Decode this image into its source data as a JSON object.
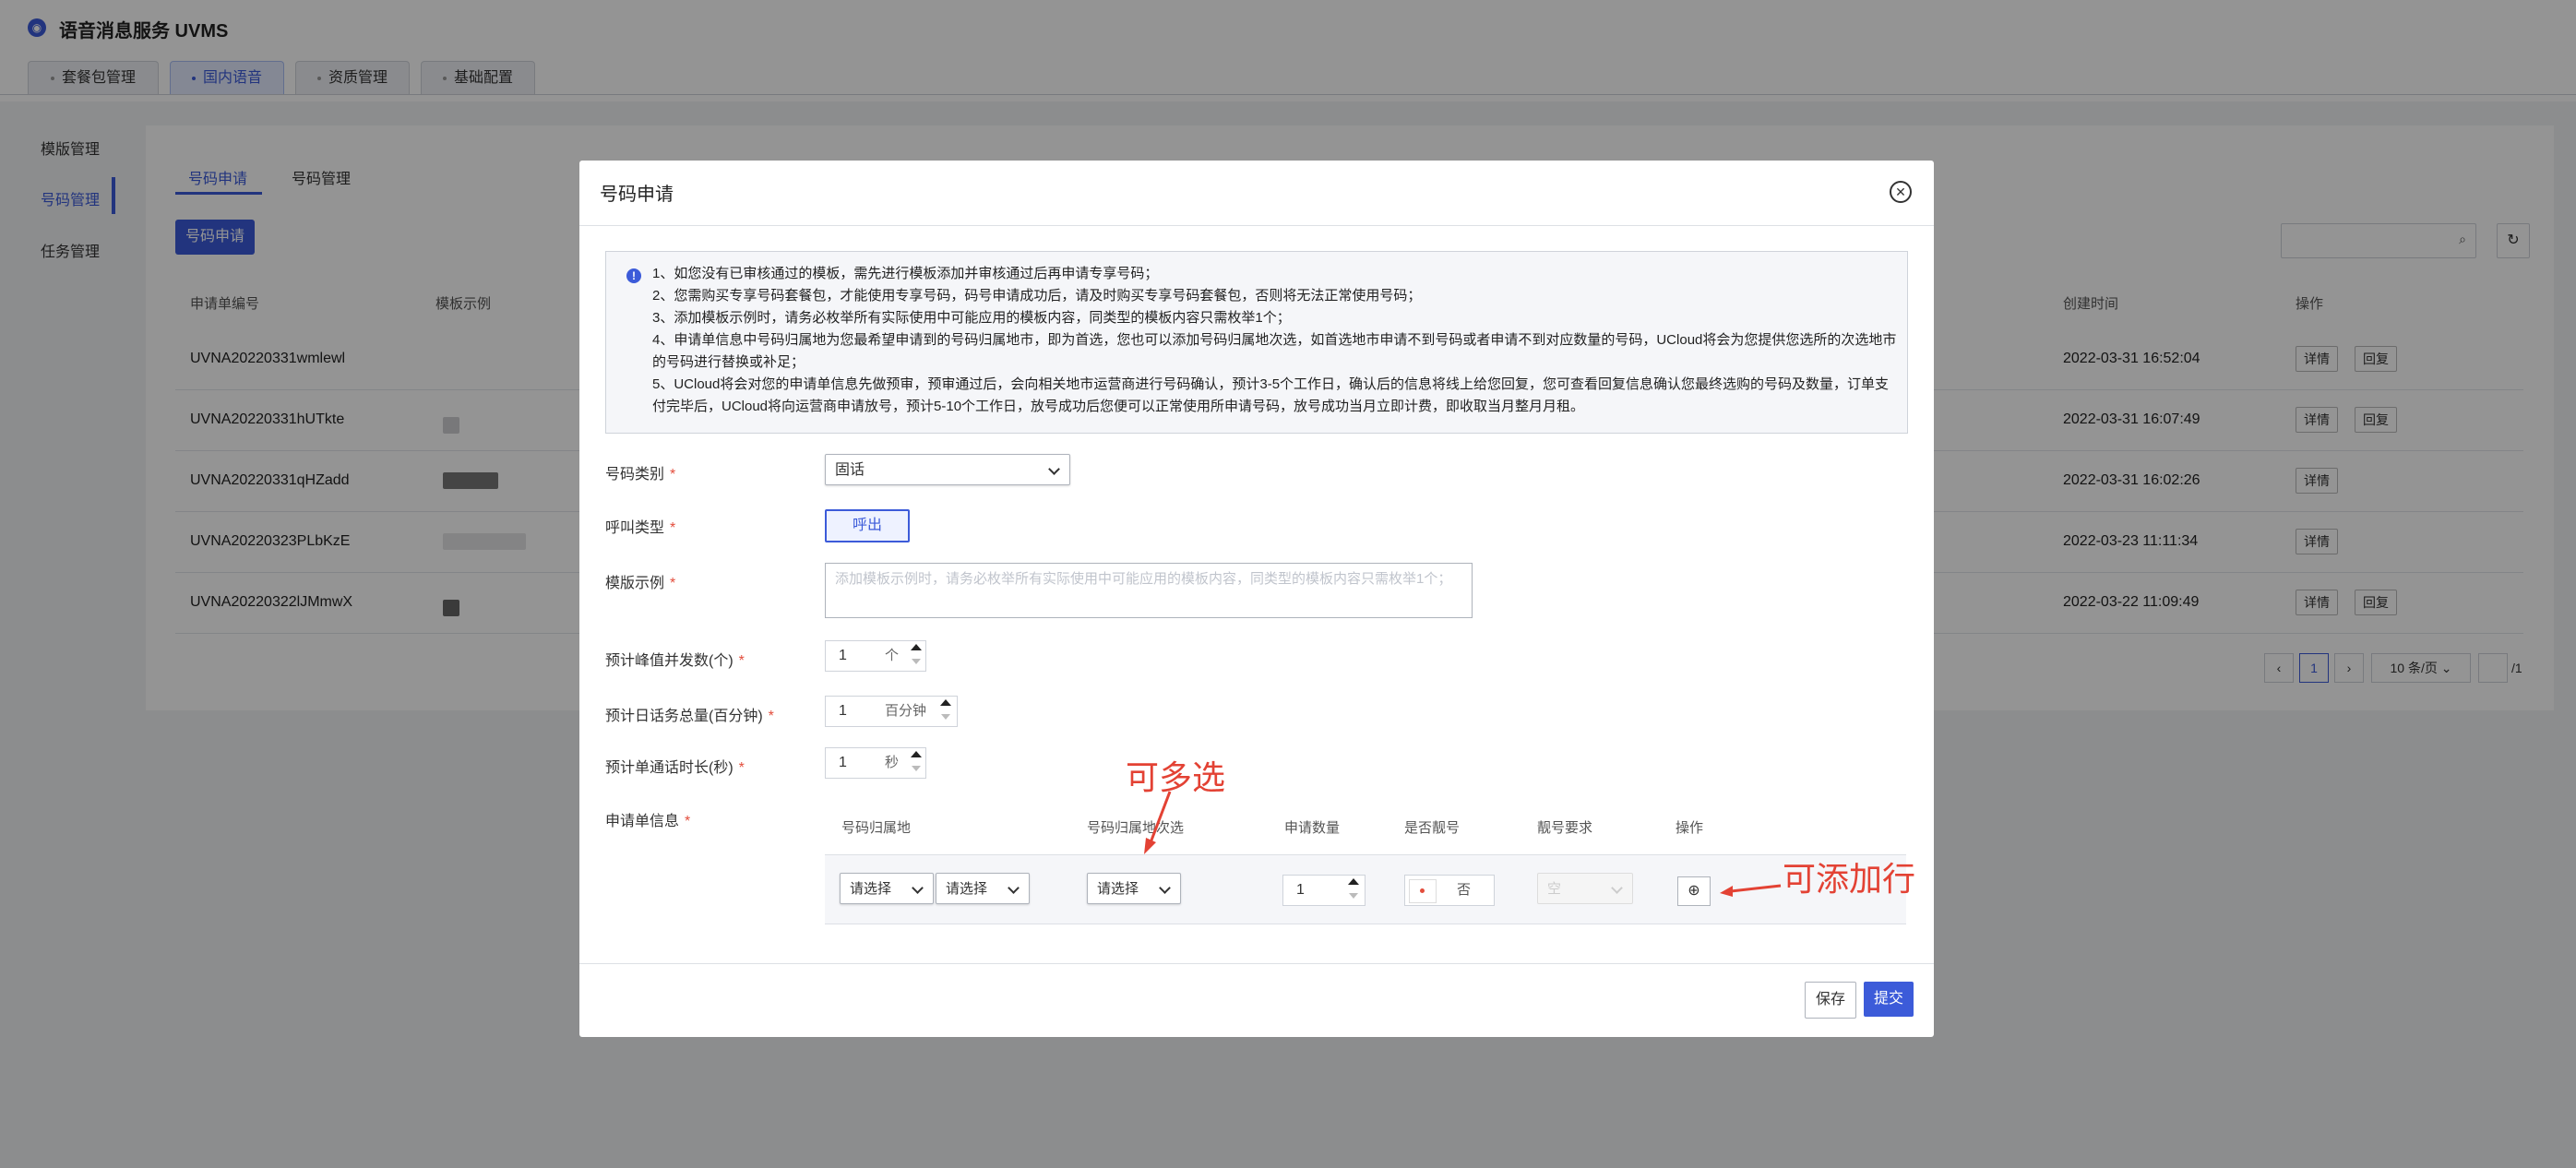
{
  "app": {
    "title": "语音消息服务 UVMS"
  },
  "top_tabs": [
    {
      "label": "套餐包管理"
    },
    {
      "label": "国内语音"
    },
    {
      "label": "资质管理"
    },
    {
      "label": "基础配置"
    }
  ],
  "sidebar": {
    "items": [
      {
        "label": "模版管理"
      },
      {
        "label": "号码管理"
      },
      {
        "label": "任务管理"
      }
    ]
  },
  "subtabs": [
    {
      "label": "号码申请"
    },
    {
      "label": "号码管理"
    }
  ],
  "apply_button": "号码申请",
  "table": {
    "headers": {
      "id": "申请单编号",
      "template": "模板示例",
      "created": "创建时间",
      "actions": "操作"
    },
    "rows": [
      {
        "id": "UVNA20220331wmlewl",
        "created": "2022-03-31 16:52:04",
        "detail": "详情",
        "reply": "回复"
      },
      {
        "id": "UVNA20220331hUTkte",
        "created": "2022-03-31 16:07:49",
        "detail": "详情",
        "reply": "回复"
      },
      {
        "id": "UVNA20220331qHZadd",
        "created": "2022-03-31 16:02:26",
        "detail": "详情",
        "reply": ""
      },
      {
        "id": "UVNA20220323PLbKzE",
        "created": "2022-03-23 11:11:34",
        "detail": "详情",
        "reply": ""
      },
      {
        "id": "UVNA20220322lJMmwX",
        "created": "2022-03-22 11:09:49",
        "detail": "详情",
        "reply": "回复"
      }
    ]
  },
  "pagination": {
    "current": "1",
    "page_size": "10 条/页",
    "total_pages": "/1"
  },
  "modal": {
    "title": "号码申请",
    "notice": [
      "1、如您没有已审核通过的模板，需先进行模板添加并审核通过后再申请专享号码；",
      "2、您需购买专享号码套餐包，才能使用专享号码，码号申请成功后，请及时购买专享号码套餐包，否则将无法正常使用号码；",
      "3、添加模板示例时，请务必枚举所有实际使用中可能应用的模板内容，同类型的模板内容只需枚举1个；",
      "4、申请单信息中号码归属地为您最希望申请到的号码归属地市，即为首选，您也可以添加号码归属地次选，如首选地市申请不到号码或者申请不到对应数量的号码，UCloud将会为您提供您选所的次选地市的号码进行替换或补足；",
      "5、UCloud将会对您的申请单信息先做预审，预审通过后，会向相关地市运营商进行号码确认，预计3-5个工作日，确认后的信息将线上给您回复，您可查看回复信息确认您最终选购的号码及数量，订单支付完毕后，UCloud将向运营商申请放号，预计5-10个工作日，放号成功后您便可以正常使用所申请号码，放号成功当月立即计费，即收取当月整月月租。"
    ],
    "fields": {
      "number_type": {
        "label": "号码类别",
        "value": "固话"
      },
      "call_type": {
        "label": "呼叫类型",
        "value": "呼出"
      },
      "template": {
        "label": "模版示例",
        "placeholder": "添加模板示例时，请务必枚举所有实际使用中可能应用的模板内容，同类型的模板内容只需枚举1个；"
      },
      "peak_concurrency": {
        "label": "预计峰值并发数(个)",
        "value": "1",
        "unit": "个"
      },
      "daily_total": {
        "label": "预计日话务总量(百分钟)",
        "value": "1",
        "unit": "百分钟"
      },
      "call_duration": {
        "label": "预计单通话时长(秒)",
        "value": "1",
        "unit": "秒"
      }
    },
    "application": {
      "label": "申请单信息",
      "headers": {
        "location": "号码归属地",
        "alt_location": "号码归属地次选",
        "quantity": "申请数量",
        "is_pretty": "是否靓号",
        "pretty_req": "靓号要求",
        "actions": "操作"
      },
      "row": {
        "province": "请选择",
        "city": "请选择",
        "alt": "请选择",
        "quantity": "1",
        "pretty_no": "否",
        "pretty_req": "空"
      }
    },
    "annotations": {
      "multi_select": "可多选",
      "add_row": "可添加行"
    },
    "buttons": {
      "save": "保存",
      "submit": "提交"
    }
  }
}
